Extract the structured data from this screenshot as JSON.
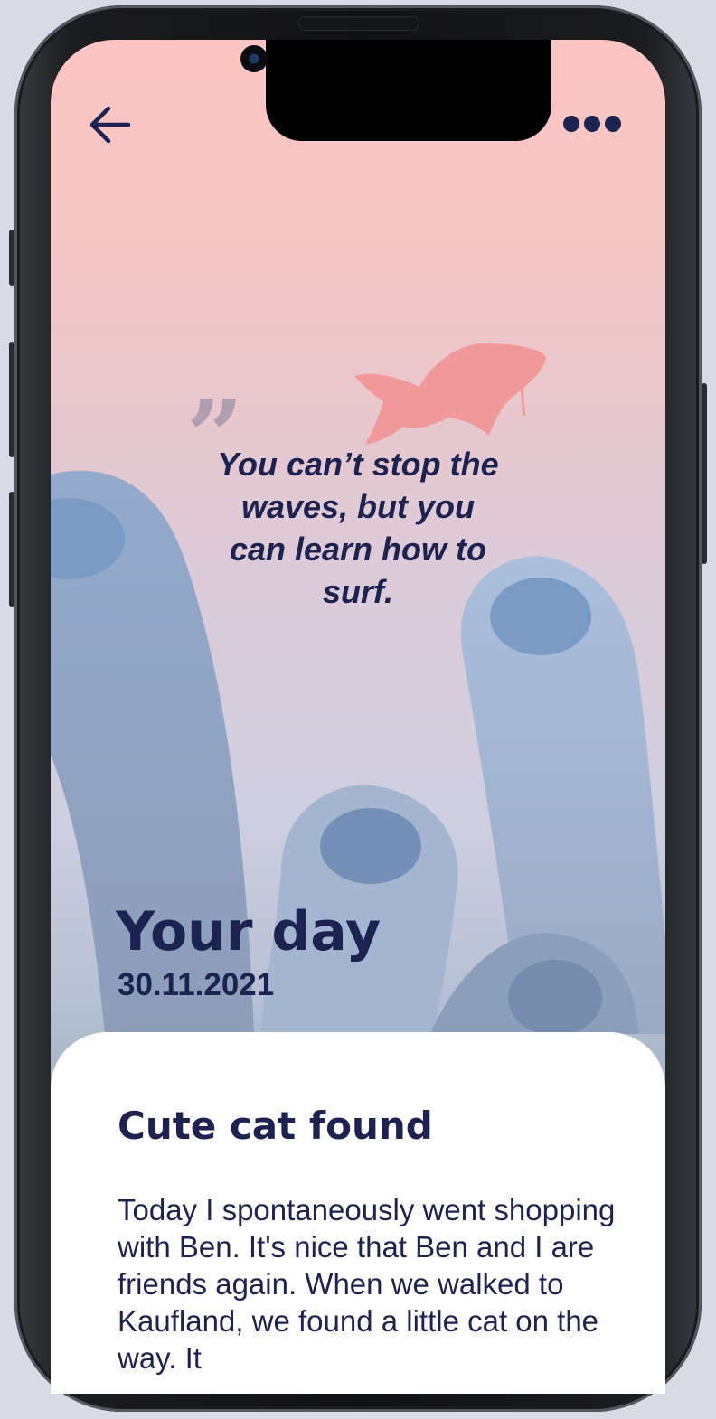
{
  "header": {
    "back_icon": "arrow-left-icon",
    "more_icon": "more-horizontal-icon"
  },
  "quote": {
    "mark": "”",
    "text": "You can’t stop the waves, but you can learn how to surf."
  },
  "day": {
    "title": "Your day",
    "date": "30.11.2021"
  },
  "entry": {
    "title": "Cute cat found",
    "body": "Today I spontaneously went shopping with Ben. It's nice that Ben and I are friends again. When we walked to Kaufland, we found a little cat on the way. It"
  },
  "colors": {
    "text": "#1d2350",
    "background_top": "#fdc5c1",
    "fish": "#f0989a",
    "coral": "#93aacd",
    "card": "#ffffff"
  }
}
